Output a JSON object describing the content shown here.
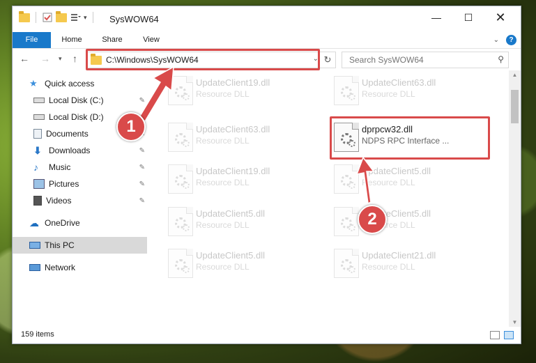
{
  "window": {
    "title": "SysWOW64"
  },
  "ribbon": {
    "tabs": [
      "File",
      "Home",
      "Share",
      "View"
    ],
    "help_label": "?"
  },
  "address": {
    "path": "C:\\Windows\\SysWOW64"
  },
  "search": {
    "placeholder": "Search SysWOW64"
  },
  "sidebar": {
    "items": [
      {
        "label": "Quick access"
      },
      {
        "label": "Local Disk (C:)"
      },
      {
        "label": "Local Disk (D:)"
      },
      {
        "label": "Documents"
      },
      {
        "label": "Downloads"
      },
      {
        "label": "Music"
      },
      {
        "label": "Pictures"
      },
      {
        "label": "Videos"
      },
      {
        "label": "OneDrive"
      },
      {
        "label": "This PC"
      },
      {
        "label": "Network"
      }
    ]
  },
  "files": [
    {
      "name": "UpdateClient19.dll",
      "desc": "Resource DLL"
    },
    {
      "name": "UpdateClient63.dll",
      "desc": "Resource DLL"
    },
    {
      "name": "UpdateClient63.dll",
      "desc": "Resource DLL"
    },
    {
      "name": "dprpcw32.dll",
      "desc": "NDPS RPC Interface ..."
    },
    {
      "name": "UpdateClient19.dll",
      "desc": "Resource DLL"
    },
    {
      "name": "UpdateClient5.dll",
      "desc": "Resource DLL"
    },
    {
      "name": "UpdateClient5.dll",
      "desc": "Resource DLL"
    },
    {
      "name": "UpdateClient5.dll",
      "desc": "Resource DLL"
    },
    {
      "name": "UpdateClient5.dll",
      "desc": "Resource DLL"
    },
    {
      "name": "UpdateClient21.dll",
      "desc": "Resource DLL"
    }
  ],
  "status": {
    "item_count": "159 items"
  },
  "annotations": {
    "step1": "1",
    "step2": "2",
    "color": "#d94a4a"
  }
}
